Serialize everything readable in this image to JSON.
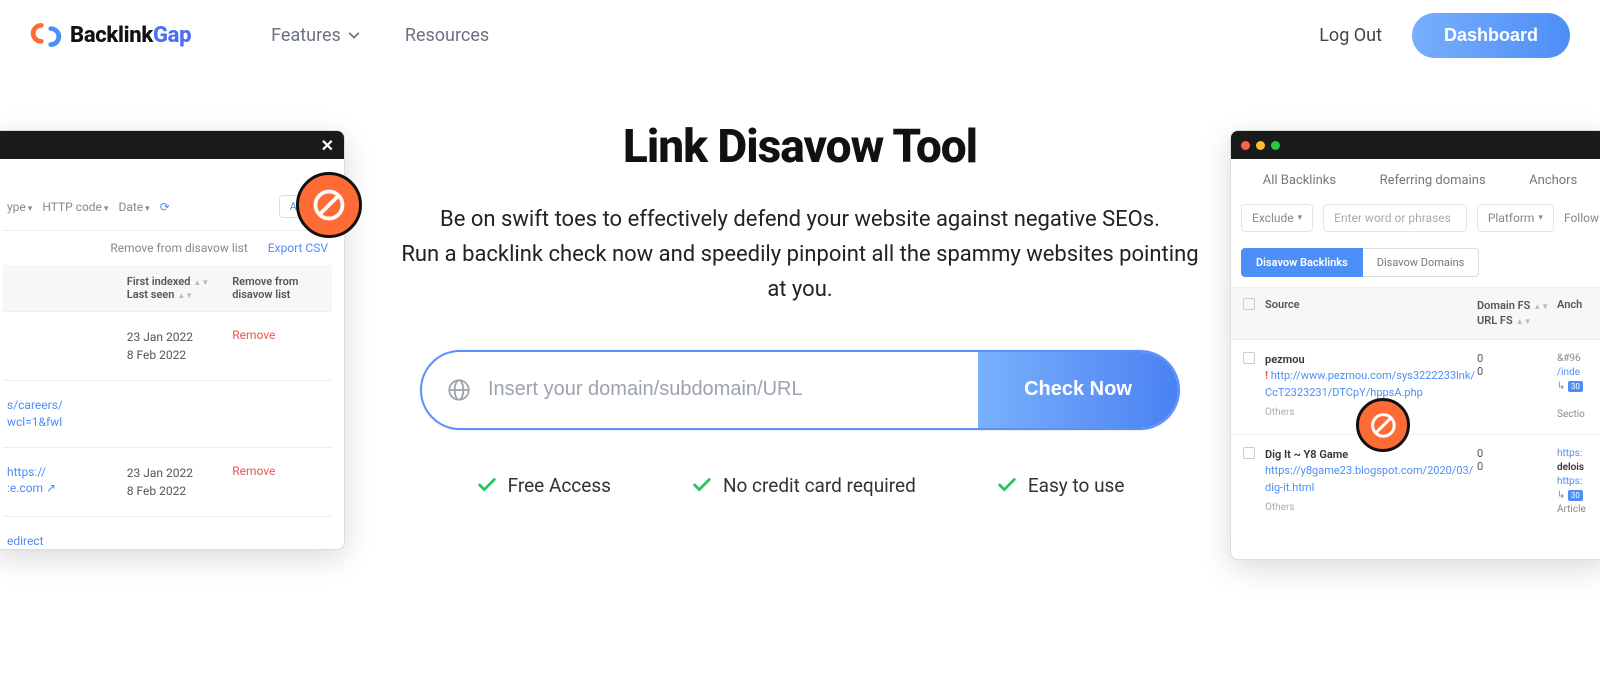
{
  "header": {
    "brand_prefix": "Backlink",
    "brand_suffix": "Gap",
    "nav": {
      "features": "Features",
      "resources": "Resources"
    },
    "logout": "Log Out",
    "dashboard": "Dashboard"
  },
  "hero": {
    "title": "Link Disavow Tool",
    "line1": "Be on swift toes to effectively defend your website against negative SEOs.",
    "line2": "Run a backlink check now and speedily pinpoint all the spammy websites pointing at you.",
    "placeholder": "Insert your domain/subdomain/URL",
    "check_button": "Check Now",
    "features": {
      "f1": "Free Access",
      "f2": "No credit card required",
      "f3": "Easy to use"
    }
  },
  "mock_left": {
    "toolbar": {
      "type": "ype",
      "http": "HTTP code",
      "date": "Date",
      "apply": "Apply"
    },
    "sub": {
      "remove_list": "Remove from disavow list",
      "export": "Export CSV"
    },
    "head": {
      "c2a": "First indexed",
      "c2b": "Last seen",
      "c3a": "Remove from",
      "c3b": "disavow list"
    },
    "rows": [
      {
        "c1": "",
        "c2a": "23 Jan 2022",
        "c2b": "8 Feb 2022",
        "c3": "Remove"
      },
      {
        "c1": "s/careers/\nwcl=1&fwl",
        "c2a": "",
        "c2b": "",
        "c3": ""
      },
      {
        "c1": "https://\n:e.com ↗",
        "c2a": "23 Jan 2022",
        "c2b": "8 Feb 2022",
        "c3": "Remove"
      },
      {
        "c1": "edirect",
        "c2a": "",
        "c2b": "",
        "c3": ""
      }
    ]
  },
  "mock_right": {
    "tabs": {
      "t1": "All Backlinks",
      "t2": "Referring domains",
      "t3": "Anchors"
    },
    "filters": {
      "exclude": "Exclude",
      "placeholder": "Enter word or phrases",
      "platform": "Platform",
      "follow": "Follow"
    },
    "pills": {
      "p1": "Disavow Backlinks",
      "p2": "Disavow Domains"
    },
    "head": {
      "source": "Source",
      "dfs1": "Domain FS",
      "dfs2": "URL FS",
      "anchor": "Anch"
    },
    "rows": [
      {
        "title": "pezmou",
        "url": "http://www.pezmou.com/sys3222233lnk/CcT2323231/DTCpY/hppsA.php",
        "others": "Others",
        "dfs1": "0",
        "dfs2": "0",
        "anc_a": "&#96",
        "anc_b": "/inde",
        "anc_tag": "30",
        "anc_c": "Sectio",
        "warn": true
      },
      {
        "title": "Dig It ~ Y8 Game",
        "url": "https://y8game23.blogspot.com/2020/03/dig-it.html",
        "others": "Others",
        "dfs1": "0",
        "dfs2": "0",
        "anc_a": "https:",
        "anc_b": "delois",
        "anc_c2": "https:",
        "anc_tag": "30",
        "anc_d": "Article",
        "warn": false
      }
    ]
  }
}
